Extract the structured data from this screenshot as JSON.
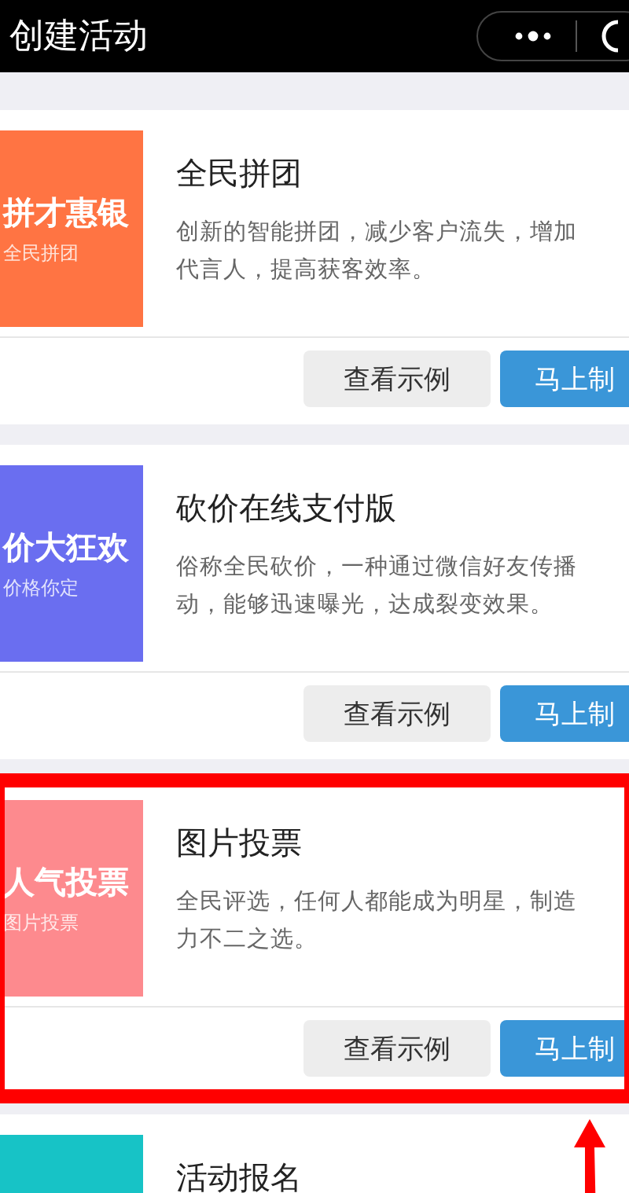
{
  "header": {
    "title": "创建活动"
  },
  "cards": [
    {
      "title": "全民拼团",
      "description_lines": [
        "创新的智能拼团，减少客户流失，增加",
        "代言人，提高获客效率。"
      ],
      "thumb": {
        "headline": "拼才惠银",
        "subline": "全民拼团",
        "color": "#ff7443"
      },
      "buttons": [
        "查看示例",
        "马上制"
      ],
      "highlighted": false
    },
    {
      "title": "砍价在线支付版",
      "description_lines": [
        "俗称全民砍价，一种通过微信好友传播",
        "动，能够迅速曝光，达成裂变效果。"
      ],
      "thumb": {
        "headline": "价大狂欢",
        "subline": "价格你定",
        "color": "#6a6ef0"
      },
      "buttons": [
        "查看示例",
        "马上制"
      ],
      "highlighted": false
    },
    {
      "title": "图片投票",
      "description_lines": [
        "全民评选，任何人都能成为明星，制造",
        "力不二之选。"
      ],
      "thumb": {
        "headline": "人气投票",
        "subline": "图片投票",
        "color": "#fd8a8e"
      },
      "buttons": [
        "查看示例",
        "马上制"
      ],
      "highlighted": true
    },
    {
      "title": "活动报名",
      "thumb": {
        "color": "#17c3c6"
      },
      "highlighted": false
    }
  ]
}
